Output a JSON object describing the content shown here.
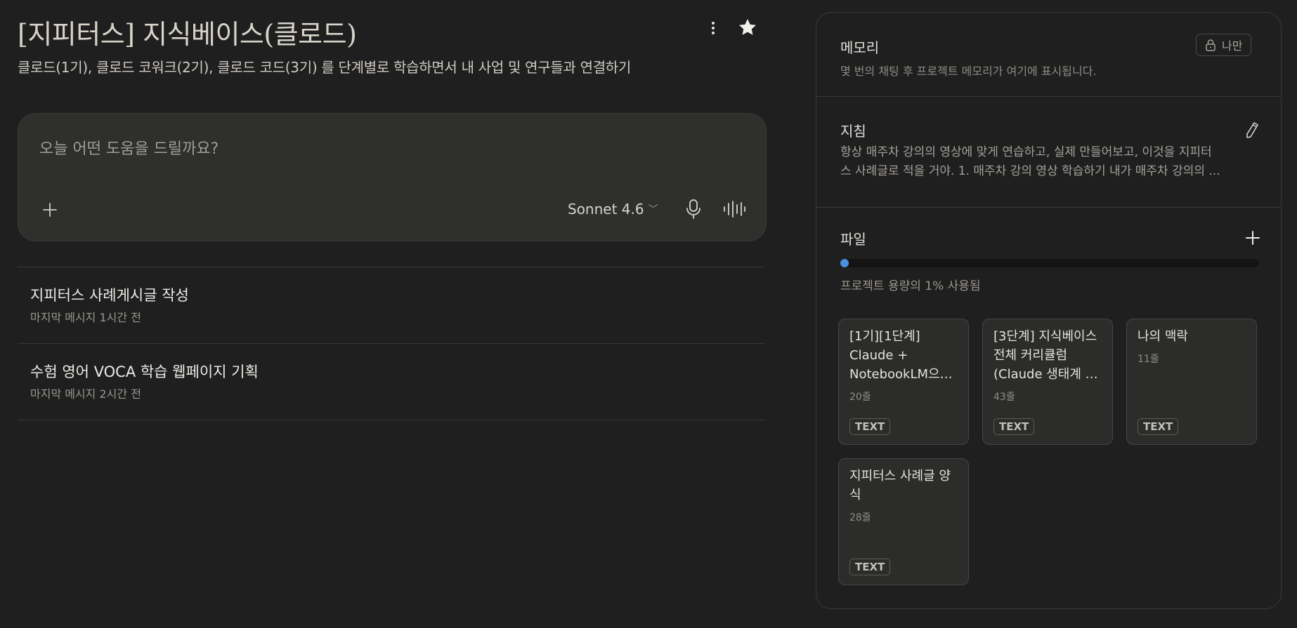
{
  "project": {
    "title": "[지피터스] 지식베이스(클로드)",
    "description": "클로드(1기), 클로드 코워크(2기), 클로드 코드(3기) 를 단계별로 학습하면서 내 사업 및 연구들과 연결하기"
  },
  "composer": {
    "placeholder": "오늘 어떤 도움을 드릴까요?",
    "model": "Sonnet 4.6"
  },
  "chats": [
    {
      "title": "지피터스 사례게시글 작성",
      "time": "마지막 메시지 1시간 전"
    },
    {
      "title": "수험 영어 VOCA 학습 웹페이지 기획",
      "time": "마지막 메시지 2시간 전"
    }
  ],
  "memory": {
    "title": "메모리",
    "subtitle": "몇 번의 채팅 후 프로젝트 메모리가 여기에 표시됩니다.",
    "privacy": "나만"
  },
  "instructions": {
    "title": "지침",
    "line1": "항상 매주차 강의의 영상에 맞게 연습하고, 실제 만들어보고, 이것을 지피터",
    "line2": "스 사례글로 적을 거야. 1. 매주차 강의 영상 학습하기 내가 매주차 강의의 ..."
  },
  "files": {
    "title": "파일",
    "usage_text": "프로젝트 용량의 1% 사용됨",
    "usage_fraction": 0.02,
    "items": [
      {
        "name": "[1기][1단계] Claude + NotebookLM으…",
        "lines": "20줄",
        "type": "TEXT"
      },
      {
        "name": "[3단계] 지식베이스 전체 커리큘럼 (Claude 생태계 …",
        "lines": "43줄",
        "type": "TEXT"
      },
      {
        "name": "나의 맥락",
        "lines": "11줄",
        "type": "TEXT"
      },
      {
        "name": "지피터스 사례글 양식",
        "lines": "28줄",
        "type": "TEXT"
      }
    ]
  },
  "colors": {
    "accent": "#4a90e2",
    "background": "#1f1f1f"
  }
}
